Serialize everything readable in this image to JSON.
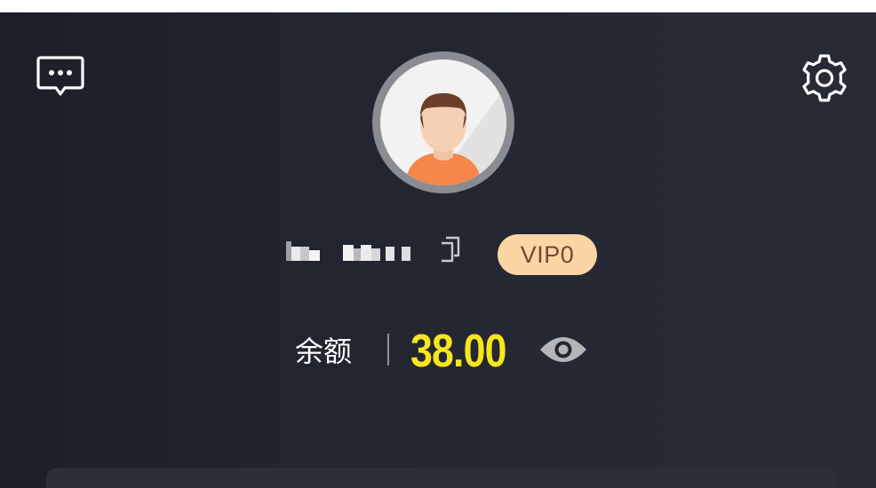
{
  "header": {
    "message_icon": "chat-bubble-icon",
    "settings_icon": "gear-icon"
  },
  "profile": {
    "avatar_icon": "default-user-avatar",
    "username": "",
    "copy_icon": "copy-icon",
    "vip_level": "VIP0"
  },
  "balance": {
    "label": "余额",
    "amount": "38.00",
    "toggle_icon": "eye-icon"
  },
  "colors": {
    "background": "#23262f",
    "amount": "#f6e61c",
    "vip_badge_bg": "#fbd6a4",
    "vip_badge_text": "#6d4a33"
  }
}
